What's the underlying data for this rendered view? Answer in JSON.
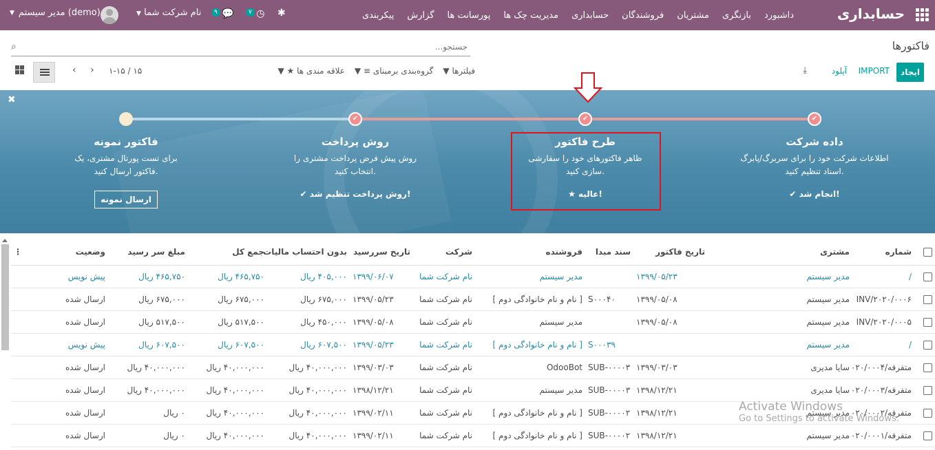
{
  "navbar": {
    "brand": "حسابداری",
    "menu": [
      "داشبورد",
      "بازنگری",
      "مشتریان",
      "فروشندگان",
      "حسابداری",
      "مدیریت چک ها",
      "پورسانت ها",
      "گزارش",
      "پیکربندی"
    ],
    "user": "مدیر سیستم (demo)",
    "company": "نام شرکت شما",
    "chat_count": "۹",
    "activity_count": "۷"
  },
  "control_panel": {
    "title": "فاکتورها",
    "search_placeholder": "جستجو...",
    "create_label": "ایجاد",
    "import_label": "IMPORT",
    "upload_label": "آپلود",
    "filters_label": "فیلترها",
    "groupby_label": "گروه‌بندی برمبنای",
    "favorites_label": "علاقه مندی ها",
    "pager": "۱-۱۵ / ۱۵"
  },
  "onboarding": {
    "steps": [
      {
        "title": "داده شرکت",
        "desc": "اطلاعات شرکت خود را برای سربرگ/پابرگ اسناد تنظیم کنید.",
        "status": "✔ انجام شد!"
      },
      {
        "title": "طرح فاکتور",
        "desc": "ظاهر فاکتورهای خود را سفارشی سازی کنید.",
        "status": "★ عالیه!"
      },
      {
        "title": "روش پرداخت",
        "desc": "روش پیش فرض پرداخت مشتری را انتخاب کنید.",
        "status": "✔ روش پرداخت تنظیم شد!"
      },
      {
        "title": "فاکتور نمونه",
        "desc": "برای تست پورتال مشتری، یک فاکتور ارسال کنید.",
        "button": "ارسال نمونه"
      }
    ]
  },
  "table": {
    "headers": [
      "شماره",
      "مشتری",
      "تاریخ فاکتور",
      "سند مبدا",
      "فروشنده",
      "شرکت",
      "تاریخ سررسید",
      "بدون احتساب مالیات",
      "جمع کل",
      "مبلغ سر رسید",
      "وضعیت"
    ],
    "rows": [
      {
        "num": "/",
        "customer": "مدیر سیستم",
        "date": "۱۳۹۹/۰۵/۲۳",
        "source": "",
        "salesperson": "مدیر سیستم",
        "company": "نام شرکت شما",
        "due": "۱۳۹۹/۰۶/۰۷",
        "untaxed": "۴۰۵,۰۰۰ ریال",
        "total": "۴۶۵,۷۵۰ ریال",
        "residual": "۴۶۵,۷۵۰ ریال",
        "state": "پیش نویس",
        "draft": true
      },
      {
        "num": "INV/۲۰۲۰/۰۰۰۶",
        "customer": "مدیر سیستم",
        "date": "۱۳۹۹/۰۵/۰۸",
        "source": "S۰۰۰۴۰",
        "salesperson": "[ نام و نام خانوادگی دوم ]",
        "company": "نام شرکت شما",
        "due": "۱۳۹۹/۰۵/۲۳",
        "untaxed": "۶۷۵,۰۰۰ ریال",
        "total": "۶۷۵,۰۰۰ ریال",
        "residual": "۶۷۵,۰۰۰ ریال",
        "state": "ارسال شده",
        "draft": false
      },
      {
        "num": "INV/۲۰۲۰/۰۰۰۵",
        "customer": "مدیر سیستم",
        "date": "۱۳۹۹/۰۵/۰۸",
        "source": "",
        "salesperson": "مدیر سیستم",
        "company": "نام شرکت شما",
        "due": "۱۳۹۹/۰۵/۰۸",
        "untaxed": "۴۵۰,۰۰۰ ریال",
        "total": "۵۱۷,۵۰۰ ریال",
        "residual": "۵۱۷,۵۰۰ ریال",
        "state": "ارسال شده",
        "draft": false
      },
      {
        "num": "/",
        "customer": "مدیر سیستم",
        "date": "",
        "source": "S۰۰۰۳۹",
        "salesperson": "[ نام و نام خانوادگی دوم ]",
        "company": "نام شرکت شما",
        "due": "۱۳۹۹/۰۵/۲۳",
        "untaxed": "۶۰۷,۵۰۰ ریال",
        "total": "۶۰۷,۵۰۰ ریال",
        "residual": "۶۰۷,۵۰۰ ریال",
        "state": "پیش نویس",
        "draft": true
      },
      {
        "num": "متفرقه/۲۰۲۰/۰۰۰۴",
        "customer": "سایا مدیری",
        "date": "۱۳۹۹/۰۳/۰۳",
        "source": "SUB-۰۰۰۰۳",
        "salesperson": "OdooBot",
        "company": "نام شرکت شما",
        "due": "۱۳۹۹/۰۳/۰۳",
        "untaxed": "۴۰,۰۰۰,۰۰۰ ریال",
        "total": "۴۰,۰۰۰,۰۰۰ ریال",
        "residual": "۴۰,۰۰۰,۰۰۰ ریال",
        "state": "ارسال شده",
        "draft": false
      },
      {
        "num": "متفرقه/۲۰۲۰/۰۰۰۳",
        "customer": "سایا مدیری",
        "date": "۱۳۹۸/۱۲/۲۱",
        "source": "SUB-۰۰۰۰۳",
        "salesperson": "مدیر سیستم",
        "company": "نام شرکت شما",
        "due": "۱۳۹۸/۱۲/۲۱",
        "untaxed": "۴۰,۰۰۰,۰۰۰ ریال",
        "total": "۴۰,۰۰۰,۰۰۰ ریال",
        "residual": "۴۰,۰۰۰,۰۰۰ ریال",
        "state": "ارسال شده",
        "draft": false
      },
      {
        "num": "متفرقه/۲۰۲۰/۰۰۰۲",
        "customer": "مدیر سیستم",
        "date": "۱۳۹۸/۱۲/۲۱",
        "source": "SUB-۰۰۰۰۲",
        "salesperson": "[ نام و نام خانوادگی دوم ]",
        "company": "نام شرکت شما",
        "due": "۱۳۹۹/۰۲/۱۱",
        "untaxed": "۴۰,۰۰۰,۰۰۰ ریال",
        "total": "۴۰,۰۰۰,۰۰۰ ریال",
        "residual": "۰ ریال",
        "state": "ارسال شده",
        "draft": false
      },
      {
        "num": "متفرقه/۲۰۲۰/۰۰۰۱",
        "customer": "مدیر سیستم",
        "date": "۱۳۹۸/۱۲/۲۱",
        "source": "SUB-۰۰۰۰۲",
        "salesperson": "[ نام و نام خانوادگی دوم ]",
        "company": "نام شرکت شما",
        "due": "۱۳۹۹/۰۲/۱۱",
        "untaxed": "۴۰,۰۰۰,۰۰۰ ریال",
        "total": "۴۰,۰۰۰,۰۰۰ ریال",
        "residual": "۰ ریال",
        "state": "ارسال شده",
        "draft": false
      }
    ]
  },
  "watermark": {
    "line1": "Activate Windows",
    "line2": "Go to Settings to activate Windows."
  },
  "colors": {
    "navbar": "#875a7b",
    "primary": "#00a09d",
    "highlight": "#e0151b",
    "link": "#268aa6"
  }
}
